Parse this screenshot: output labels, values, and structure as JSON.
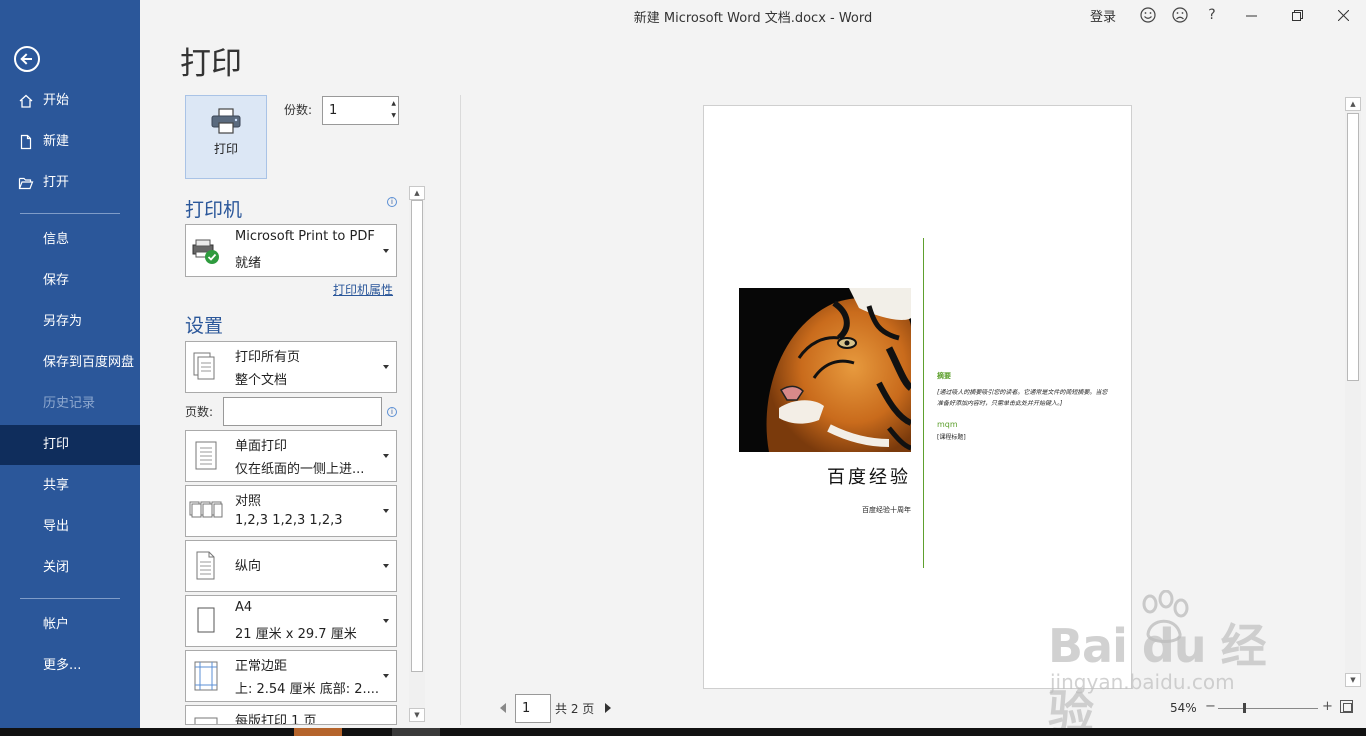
{
  "window": {
    "title": "新建 Microsoft Word 文档.docx  -  Word",
    "signin": "登录",
    "help": "?"
  },
  "sidebar": {
    "items": [
      {
        "label": "开始",
        "icon": "home-icon"
      },
      {
        "label": "新建",
        "icon": "new-document-icon"
      },
      {
        "label": "打开",
        "icon": "open-folder-icon"
      },
      {
        "label": "信息"
      },
      {
        "label": "保存"
      },
      {
        "label": "另存为"
      },
      {
        "label": "保存到百度网盘"
      },
      {
        "label": "历史记录",
        "disabled": true
      },
      {
        "label": "打印",
        "active": true
      },
      {
        "label": "共享"
      },
      {
        "label": "导出"
      },
      {
        "label": "关闭"
      },
      {
        "label": "帐户"
      },
      {
        "label": "更多..."
      }
    ]
  },
  "print": {
    "heading": "打印",
    "button_label": "打印",
    "copies_label": "份数:",
    "copies_value": "1"
  },
  "printer": {
    "section_title": "打印机",
    "name": "Microsoft Print to PDF",
    "status": "就绪",
    "properties_link": "打印机属性"
  },
  "settings": {
    "section_title": "设置",
    "pages_label": "页数:",
    "pages_value": "",
    "range": {
      "line1": "打印所有页",
      "line2": "整个文档"
    },
    "sides": {
      "line1": "单面打印",
      "line2": "仅在纸面的一侧上进..."
    },
    "collate": {
      "line1": "对照",
      "line2": "1,2,3    1,2,3    1,2,3"
    },
    "orientation": {
      "line1": "纵向"
    },
    "paper": {
      "line1": "A4",
      "line2": "21 厘米 x 29.7 厘米"
    },
    "margins": {
      "line1": "正常边距",
      "line2": "上: 2.54 厘米 底部: 2...."
    },
    "per_sheet": {
      "line1": "每版打印 1 页"
    }
  },
  "preview": {
    "doc_title": "百度经验",
    "doc_subtitle": "百度经验十周年",
    "abstract_heading": "摘要",
    "abstract_text": "[通过吸人的摘要吸引您的读者。它通常是文件的简短摘要。当您准备好添加内容时，只需单击此处并开始键入。]",
    "author": "mqm",
    "course": "[课程标题]"
  },
  "pager": {
    "current_page": "1",
    "total_label": "共 2 页"
  },
  "zoom": {
    "value": "54%",
    "minus": "−",
    "plus": "+",
    "level_percent": 54
  },
  "watermark": {
    "brand": "Bai du 经验",
    "url": "jingyan.baidu.com"
  },
  "colors": {
    "sidebar": "#2b579a",
    "sidebar_active": "#0f2d5c",
    "accent_green": "#5ea02e"
  }
}
